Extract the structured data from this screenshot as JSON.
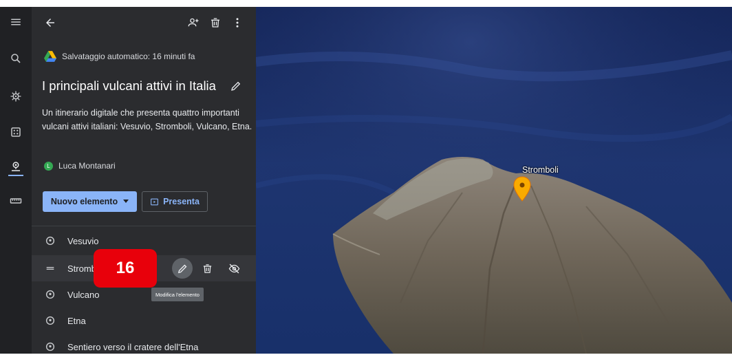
{
  "toolbar": {
    "back_icon": "arrow-back-icon",
    "share_icon": "person-add-icon",
    "delete_icon": "trash-icon",
    "more_icon": "more-vert-icon"
  },
  "rail": {
    "items": [
      {
        "name": "menu-icon"
      },
      {
        "name": "search-icon"
      },
      {
        "name": "voyager-icon"
      },
      {
        "name": "feeling-lucky-icon"
      },
      {
        "name": "projects-icon"
      },
      {
        "name": "ruler-icon"
      }
    ]
  },
  "project": {
    "autosave": "Salvataggio automatico: 16 minuti fa",
    "title": "I principali vulcani attivi in Italia",
    "description": "Un itinerario digitale che presenta quattro importanti vulcani attivi italiani: Vesuvio, Stromboli, Vulcano, Etna.",
    "author_initial": "L",
    "author": "Luca Montanari"
  },
  "buttons": {
    "new_item": "Nuovo elemento",
    "present": "Presenta"
  },
  "items": [
    {
      "label": "Vesuvio"
    },
    {
      "label": "Stromboli"
    },
    {
      "label": "Vulcano"
    },
    {
      "label": "Etna"
    },
    {
      "label": "Sentiero verso il cratere dell'Etna"
    }
  ],
  "badge": "16",
  "tooltip": "Modifica l'elemento",
  "map": {
    "place_label": "Stromboli",
    "pin_color": "#f9ab00"
  },
  "colors": {
    "accent": "#8ab4f8",
    "panel": "#2b2c2f",
    "badge": "#e8000b"
  }
}
